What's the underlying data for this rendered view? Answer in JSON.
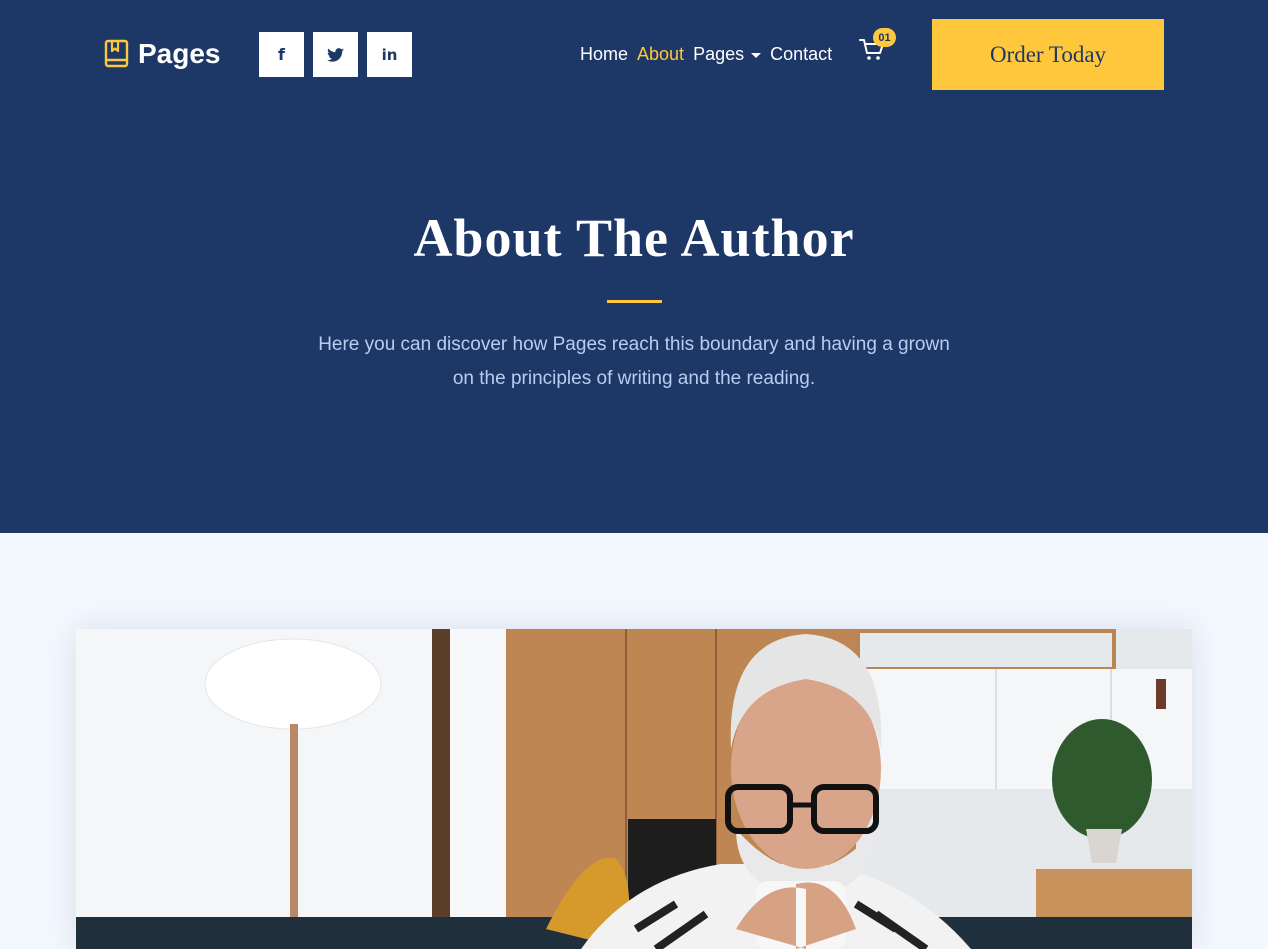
{
  "brand": {
    "name": "Pages",
    "icon": "book-icon"
  },
  "socials": [
    {
      "name": "facebook-icon",
      "glyph": "f"
    },
    {
      "name": "twitter-icon",
      "glyph": "t"
    },
    {
      "name": "linkedin-icon",
      "glyph": "in"
    }
  ],
  "nav": {
    "home": "Home",
    "about": "About",
    "pages": "Pages",
    "contact": "Contact"
  },
  "cart": {
    "icon": "cart-icon",
    "count": "01"
  },
  "cta": {
    "label": "Order Today"
  },
  "hero": {
    "title": "About The Author",
    "subtitle": "Here you can discover how Pages reach this boundary and having a grown on the principles of writing and the reading."
  },
  "colors": {
    "navy": "#1d3766",
    "accent": "#ffc83c",
    "subtitle": "#b8cdf0",
    "page_bg": "#f3f7fe"
  }
}
